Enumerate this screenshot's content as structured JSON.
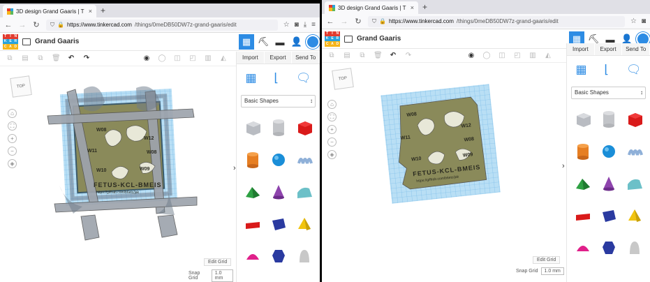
{
  "browser": {
    "tab_title": "3D design Grand Gaaris | T",
    "tab_close": "×",
    "new_tab": "+",
    "url_host": "https://www.tinkercad.com",
    "url_path": "/things/0meDB50DW7z-grand-gaaris/edit"
  },
  "app": {
    "design_name": "Grand Gaaris",
    "logo_letters": [
      "TIN",
      "KER",
      "CAD"
    ],
    "actions": {
      "import": "Import",
      "export": "Export",
      "send_to": "Send To"
    },
    "shapes_category": "Basic Shapes",
    "edit_grid": "Edit Grid",
    "snap_grid_label": "Snap Grid",
    "snap_grid_value": "1.0 mm",
    "viewcube_label": "TOP",
    "collapse_icon": "›"
  },
  "model": {
    "text_line": "FETUS-KCL-BMEIS",
    "url_line": "https://giffrab.com/b6etc/jak",
    "labels": [
      "W08",
      "W12",
      "W11",
      "W08",
      "W10",
      "W09"
    ]
  },
  "colors": {
    "accent": "#2d8ce4",
    "plate": "#8a8a5a",
    "grid_blue": "#8fc9ec"
  }
}
